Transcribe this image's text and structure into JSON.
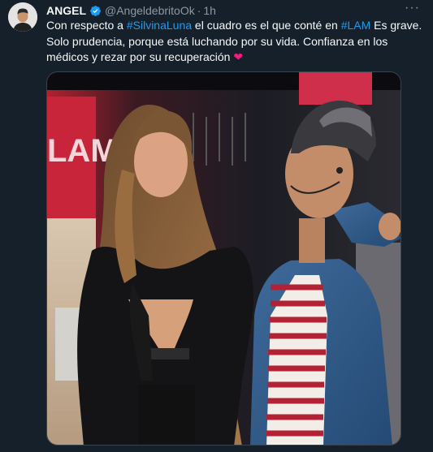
{
  "tweet": {
    "author_name": "ANGEL",
    "handle": "@AngeldebritoOk",
    "separator": "·",
    "time": "1h",
    "more_label": "···",
    "text_parts": {
      "p1": "Con respecto a ",
      "tag1": "#SilvinaLuna",
      "p2": " el cuadro es el que conté en ",
      "tag2": "#LAM",
      "p3": " Es grave. Solo prudencia, porque está luchando por su vida. Confianza en los médicos y rezar por su recuperación ",
      "heart": "❤"
    },
    "media": {
      "logo_text": "LAM"
    }
  },
  "colors": {
    "background": "#15202b",
    "link": "#1d9bf0",
    "verified": "#1d9bf0",
    "secondary_text": "#8b98a5",
    "heart": "#f91880"
  }
}
